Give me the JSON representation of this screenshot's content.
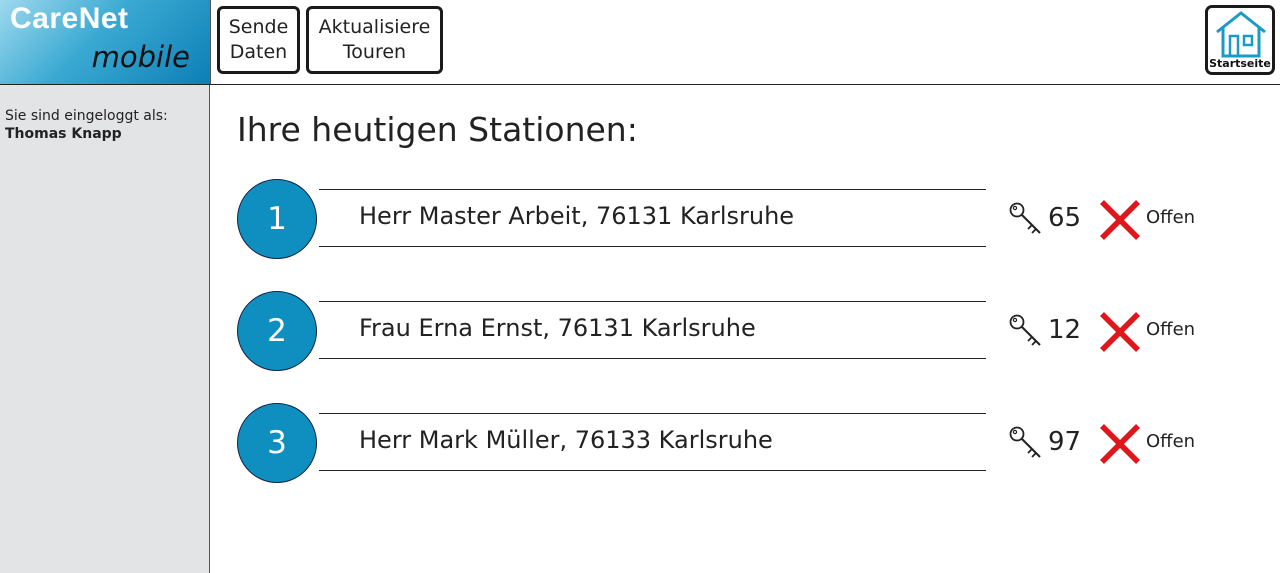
{
  "brand": {
    "name": "CareNet",
    "sub": "mobile"
  },
  "toolbar": {
    "send_line1": "Sende",
    "send_line2": "Daten",
    "update_line1": "Aktualisiere",
    "update_line2": "Touren",
    "home_label": "Startseite"
  },
  "sidebar": {
    "logged_label": "Sie sind eingeloggt als:",
    "user": "Thomas Knapp"
  },
  "main": {
    "title": "Ihre heutigen Stationen:",
    "stations": [
      {
        "number": "1",
        "address": "Herr Master Arbeit, 76131 Karlsruhe",
        "key": "65",
        "status": "Offen"
      },
      {
        "number": "2",
        "address": "Frau Erna Ernst, 76131 Karlsruhe",
        "key": "12",
        "status": "Offen"
      },
      {
        "number": "3",
        "address": "Herr Mark Müller, 76133 Karlsruhe",
        "key": "97",
        "status": "Offen"
      }
    ]
  },
  "colors": {
    "accent": "#0f8fbf",
    "status_open": "#e0161c",
    "sidebar_bg": "#e3e4e6"
  },
  "icons": {
    "home": "house-icon",
    "key": "key-icon",
    "status": "x-mark-icon"
  }
}
